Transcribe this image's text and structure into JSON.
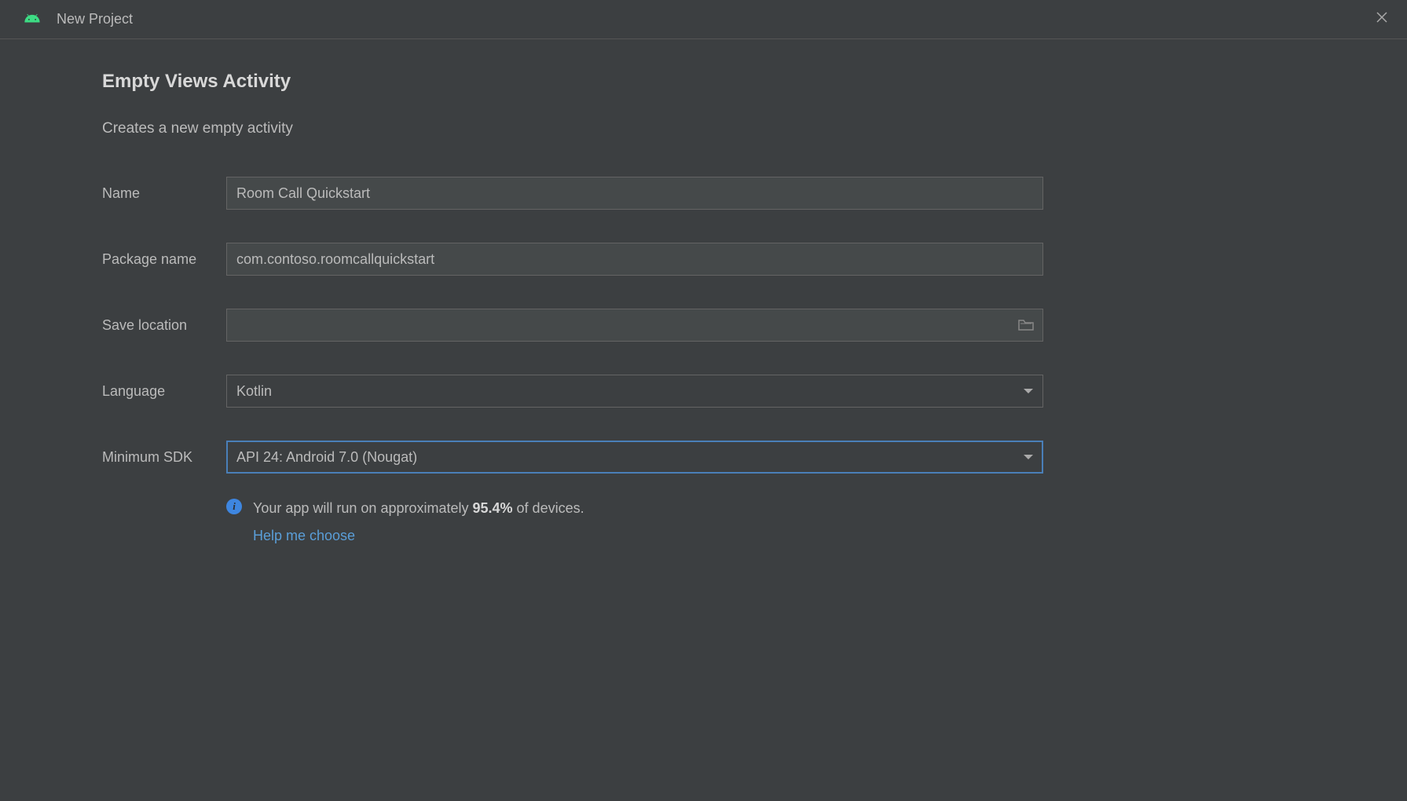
{
  "window": {
    "title": "New Project"
  },
  "page": {
    "heading": "Empty Views Activity",
    "subtitle": "Creates a new empty activity"
  },
  "form": {
    "name": {
      "label": "Name",
      "value": "Room Call Quickstart"
    },
    "package_name": {
      "label": "Package name",
      "value": "com.contoso.roomcallquickstart"
    },
    "save_location": {
      "label": "Save location",
      "value": ""
    },
    "language": {
      "label": "Language",
      "value": "Kotlin"
    },
    "min_sdk": {
      "label": "Minimum SDK",
      "value": "API 24: Android 7.0 (Nougat)"
    }
  },
  "info": {
    "prefix": "Your app will run on approximately ",
    "percent": "95.4%",
    "suffix": " of devices.",
    "help_link": "Help me choose"
  },
  "colors": {
    "bg": "#3c3f41",
    "input_bg": "#45494a",
    "border": "#646464",
    "text": "#bbbbbb",
    "focus_border": "#4a7fb8",
    "link": "#5a9ed8",
    "info_icon": "#3e86e0",
    "android_icon": "#3ddc84"
  }
}
